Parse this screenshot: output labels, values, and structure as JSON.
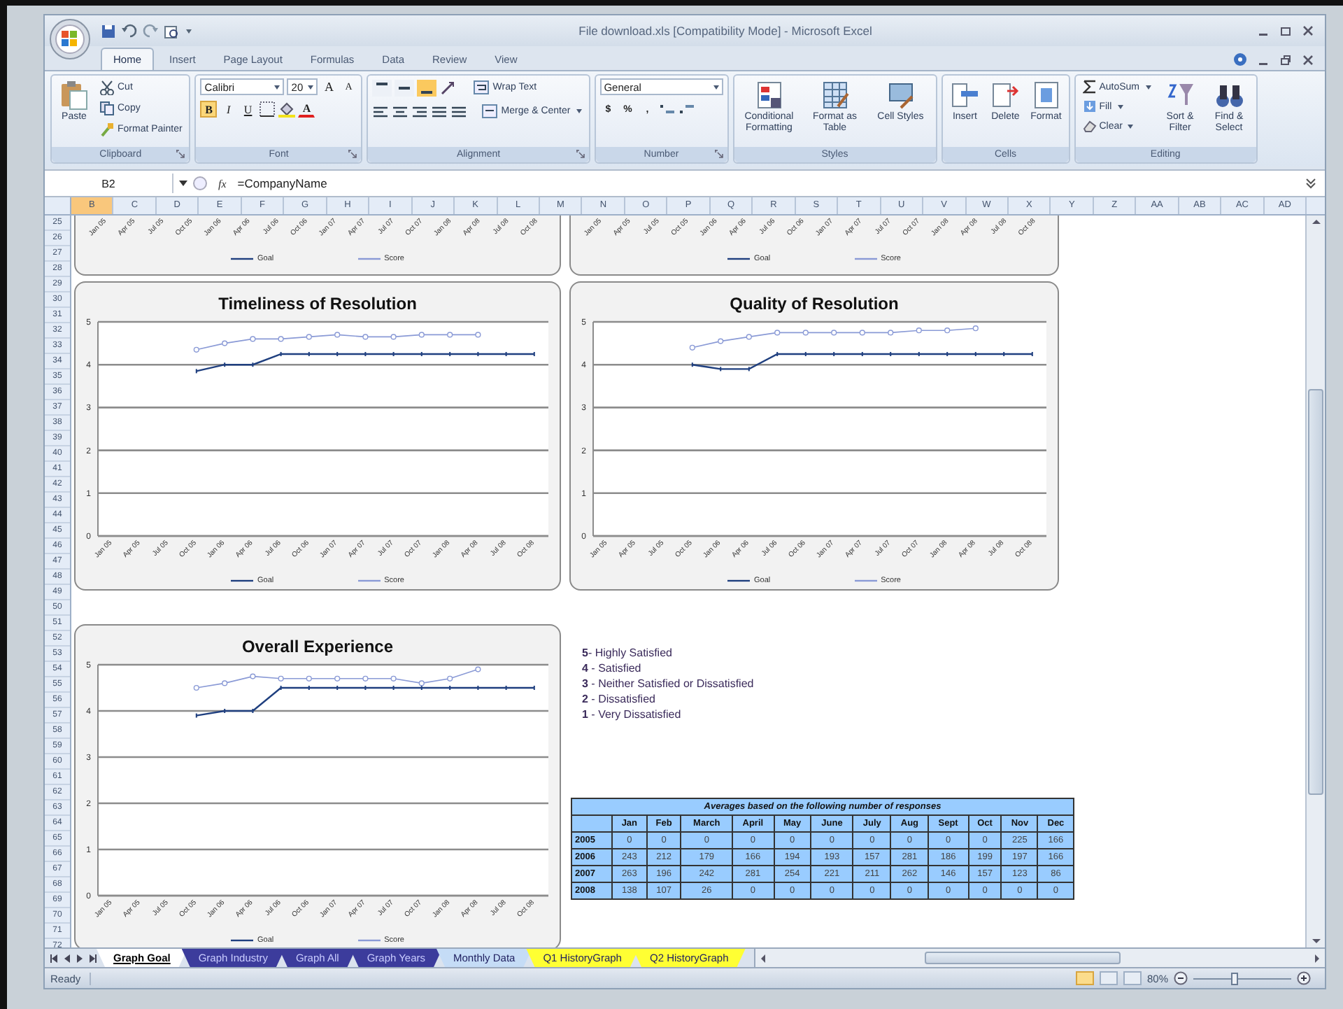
{
  "window": {
    "title": "File download.xls  [Compatibility Mode] - Microsoft Excel"
  },
  "ribbon_tabs": [
    {
      "label": "Home",
      "selected": true
    },
    {
      "label": "Insert",
      "selected": false
    },
    {
      "label": "Page Layout",
      "selected": false
    },
    {
      "label": "Formulas",
      "selected": false
    },
    {
      "label": "Data",
      "selected": false
    },
    {
      "label": "Review",
      "selected": false
    },
    {
      "label": "View",
      "selected": false
    }
  ],
  "ribbon_groups": [
    {
      "kind": "clipboard",
      "label": "Clipboard",
      "launcher": true,
      "paste": "Paste",
      "buttons": [
        "Cut",
        "Copy",
        "Format Painter"
      ]
    },
    {
      "kind": "font",
      "label": "Font",
      "launcher": true,
      "font_name": "Calibri",
      "font_size": "20",
      "size_buttons": [
        "A",
        "A"
      ],
      "format_buttons": [
        {
          "label": "B",
          "selected": true
        },
        {
          "label": "I",
          "selected": false
        },
        {
          "label": "U",
          "selected": false
        }
      ],
      "font_color": "A"
    },
    {
      "kind": "alignment",
      "label": "Alignment",
      "launcher": true,
      "vertical_align": [
        {
          "selected": false
        },
        {
          "selected": false
        },
        {
          "selected": true
        }
      ],
      "wrap_text": "Wrap Text",
      "merge": "Merge & Center"
    },
    {
      "kind": "number",
      "label": "Number",
      "launcher": true,
      "format": "General",
      "buttons": [
        "$",
        "%",
        ","
      ]
    },
    {
      "kind": "styles",
      "label": "Styles",
      "launcher": false,
      "buttons": [
        "Conditional Formatting",
        "Format as Table",
        "Cell Styles"
      ]
    },
    {
      "kind": "cells",
      "label": "Cells",
      "launcher": false,
      "buttons": [
        "Insert",
        "Delete",
        "Format"
      ]
    },
    {
      "kind": "editing",
      "label": "Editing",
      "launcher": false,
      "small_buttons": [
        "AutoSum",
        "Fill",
        "Clear"
      ],
      "buttons": [
        "Sort & Filter",
        "Find & Select"
      ]
    }
  ],
  "formula_bar": {
    "name_box": "B2",
    "fx": "fx",
    "formula": "=CompanyName"
  },
  "columns": [
    "B",
    "C",
    "D",
    "E",
    "F",
    "G",
    "H",
    "I",
    "J",
    "K",
    "L",
    "M",
    "N",
    "O",
    "P",
    "Q",
    "R",
    "S",
    "T",
    "U",
    "V",
    "W",
    "X",
    "Y",
    "Z",
    "AA",
    "AB",
    "AC",
    "AD"
  ],
  "rows": [
    "25",
    "26",
    "27",
    "28",
    "29",
    "30",
    "31",
    "32",
    "33",
    "34",
    "35",
    "36",
    "37",
    "38",
    "39",
    "40",
    "41",
    "42",
    "43",
    "44",
    "45",
    "46",
    "47",
    "48",
    "49",
    "50",
    "51",
    "52",
    "53",
    "54",
    "55",
    "56",
    "57",
    "58",
    "59",
    "60",
    "61",
    "62",
    "63",
    "64",
    "65",
    "66",
    "67",
    "68",
    "69",
    "70",
    "71",
    "72"
  ],
  "partial_charts": [
    {
      "xtick_labels": [
        "Jan 05",
        "Apr 05",
        "Jul 05",
        "Oct 05",
        "Jan 06",
        "Apr 06",
        "Jul 06",
        "Oct 06",
        "Jan 07",
        "Apr 07",
        "Jul 07",
        "Oct 07",
        "Jan 08",
        "Apr 08",
        "Jul 08",
        "Oct 08"
      ],
      "legend": [
        {
          "name": "Goal",
          "color": "#1f3f7f"
        },
        {
          "name": "Score",
          "color": "#8a9ad6"
        }
      ]
    },
    {
      "xtick_labels": [
        "Jan 05",
        "Apr 05",
        "Jul 05",
        "Oct 05",
        "Jan 06",
        "Apr 06",
        "Jul 06",
        "Oct 06",
        "Jan 07",
        "Apr 07",
        "Jul 07",
        "Oct 07",
        "Jan 08",
        "Apr 08",
        "Jul 08",
        "Oct 08"
      ],
      "legend": [
        {
          "name": "Goal",
          "color": "#1f3f7f"
        },
        {
          "name": "Score",
          "color": "#8a9ad6"
        }
      ]
    }
  ],
  "charts": [
    {
      "chart_data": {
        "type": "line",
        "title": "Timeliness of Resolution",
        "grid": true,
        "ylim": [
          0,
          5
        ],
        "yticks": [
          0,
          1,
          2,
          3,
          4,
          5
        ],
        "categories": [
          "Jan 05",
          "Apr 05",
          "Jul 05",
          "Oct 05",
          "Jan 06",
          "Apr 06",
          "Jul 06",
          "Oct 06",
          "Jan 07",
          "Apr 07",
          "Jul 07",
          "Oct 07",
          "Jan 08",
          "Apr 08",
          "Jul 08",
          "Oct 08"
        ],
        "series": [
          {
            "name": "Goal",
            "color": "#1f3f7f",
            "values": [
              null,
              null,
              null,
              3.85,
              4.0,
              4.0,
              4.25,
              4.25,
              4.25,
              4.25,
              4.25,
              4.25,
              4.25,
              4.25,
              4.25,
              4.25
            ]
          },
          {
            "name": "Score",
            "color": "#8a9ad6",
            "values": [
              null,
              null,
              null,
              4.35,
              4.5,
              4.6,
              4.6,
              4.65,
              4.7,
              4.65,
              4.65,
              4.7,
              4.7,
              4.7,
              null,
              null
            ]
          }
        ]
      }
    },
    {
      "chart_data": {
        "type": "line",
        "title": "Quality of Resolution",
        "grid": true,
        "ylim": [
          0,
          5
        ],
        "yticks": [
          0,
          1,
          2,
          3,
          4,
          5
        ],
        "categories": [
          "Jan 05",
          "Apr 05",
          "Jul 05",
          "Oct 05",
          "Jan 06",
          "Apr 06",
          "Jul 06",
          "Oct 06",
          "Jan 07",
          "Apr 07",
          "Jul 07",
          "Oct 07",
          "Jan 08",
          "Apr 08",
          "Jul 08",
          "Oct 08"
        ],
        "series": [
          {
            "name": "Goal",
            "color": "#1f3f7f",
            "values": [
              null,
              null,
              null,
              4.0,
              3.9,
              3.9,
              4.25,
              4.25,
              4.25,
              4.25,
              4.25,
              4.25,
              4.25,
              4.25,
              4.25,
              4.25
            ]
          },
          {
            "name": "Score",
            "color": "#8a9ad6",
            "values": [
              null,
              null,
              null,
              4.4,
              4.55,
              4.65,
              4.75,
              4.75,
              4.75,
              4.75,
              4.75,
              4.8,
              4.8,
              4.85,
              null,
              null
            ]
          }
        ]
      }
    },
    {
      "chart_data": {
        "type": "line",
        "title": "Overall Experience",
        "grid": true,
        "ylim": [
          0,
          5
        ],
        "yticks": [
          0,
          1,
          2,
          3,
          4,
          5
        ],
        "categories": [
          "Jan 05",
          "Apr 05",
          "Jul 05",
          "Oct 05",
          "Jan 06",
          "Apr 06",
          "Jul 06",
          "Oct 06",
          "Jan 07",
          "Apr 07",
          "Jul 07",
          "Oct 07",
          "Jan 08",
          "Apr 08",
          "Jul 08",
          "Oct 08"
        ],
        "series": [
          {
            "name": "Goal",
            "color": "#1f3f7f",
            "values": [
              null,
              null,
              null,
              3.9,
              4.0,
              4.0,
              4.5,
              4.5,
              4.5,
              4.5,
              4.5,
              4.5,
              4.5,
              4.5,
              4.5,
              4.5
            ]
          },
          {
            "name": "Score",
            "color": "#8a9ad6",
            "values": [
              null,
              null,
              null,
              4.5,
              4.6,
              4.75,
              4.7,
              4.7,
              4.7,
              4.7,
              4.7,
              4.6,
              4.7,
              4.9,
              null,
              null
            ]
          }
        ]
      }
    }
  ],
  "scale_legend": [
    "**5**- Highly Satisfied",
    "**4** - Satisfied",
    "**3** - Neither Satisfied or Dissatisfied",
    "**2** - Dissatisfied",
    "**1** - Very Dissatisfied"
  ],
  "responses_table": {
    "caption": "Averages based on the following number of responses",
    "columns": [
      "Jan",
      "Feb",
      "March",
      "April",
      "May",
      "June",
      "July",
      "Aug",
      "Sept",
      "Oct",
      "Nov",
      "Dec"
    ],
    "rows": [
      {
        "year": "2005",
        "values": [
          "0",
          "0",
          "0",
          "0",
          "0",
          "0",
          "0",
          "0",
          "0",
          "0",
          "225",
          "166"
        ]
      },
      {
        "year": "2006",
        "values": [
          "243",
          "212",
          "179",
          "166",
          "194",
          "193",
          "157",
          "281",
          "186",
          "199",
          "197",
          "166"
        ]
      },
      {
        "year": "2007",
        "values": [
          "263",
          "196",
          "242",
          "281",
          "254",
          "221",
          "211",
          "262",
          "146",
          "157",
          "123",
          "86"
        ]
      },
      {
        "year": "2008",
        "values": [
          "138",
          "107",
          "26",
          "0",
          "0",
          "0",
          "0",
          "0",
          "0",
          "0",
          "0",
          "0"
        ]
      }
    ]
  },
  "sheet_tabs": [
    {
      "label": "Graph Goal",
      "color": "#ffffff",
      "selected": true
    },
    {
      "label": "Graph Industry",
      "color": "#3c3c9c",
      "selected": false
    },
    {
      "label": "Graph All",
      "color": "#3c3c9c",
      "selected": false
    },
    {
      "label": "Graph Years",
      "color": "#3c3c9c",
      "selected": false
    },
    {
      "label": "Monthly Data",
      "color": "#c5dcf6",
      "selected": false
    },
    {
      "label": "Q1 HistoryGraph",
      "color": "#ffff33",
      "selected": false
    },
    {
      "label": "Q2 HistoryGraph",
      "color": "#ffff33",
      "selected": false
    }
  ],
  "status_bar": {
    "status": "Ready",
    "view_buttons": [
      {
        "selected": true
      },
      {
        "selected": false
      },
      {
        "selected": false
      }
    ],
    "zoom": "80%",
    "zoom_slider": {
      "level": 0.41
    }
  }
}
